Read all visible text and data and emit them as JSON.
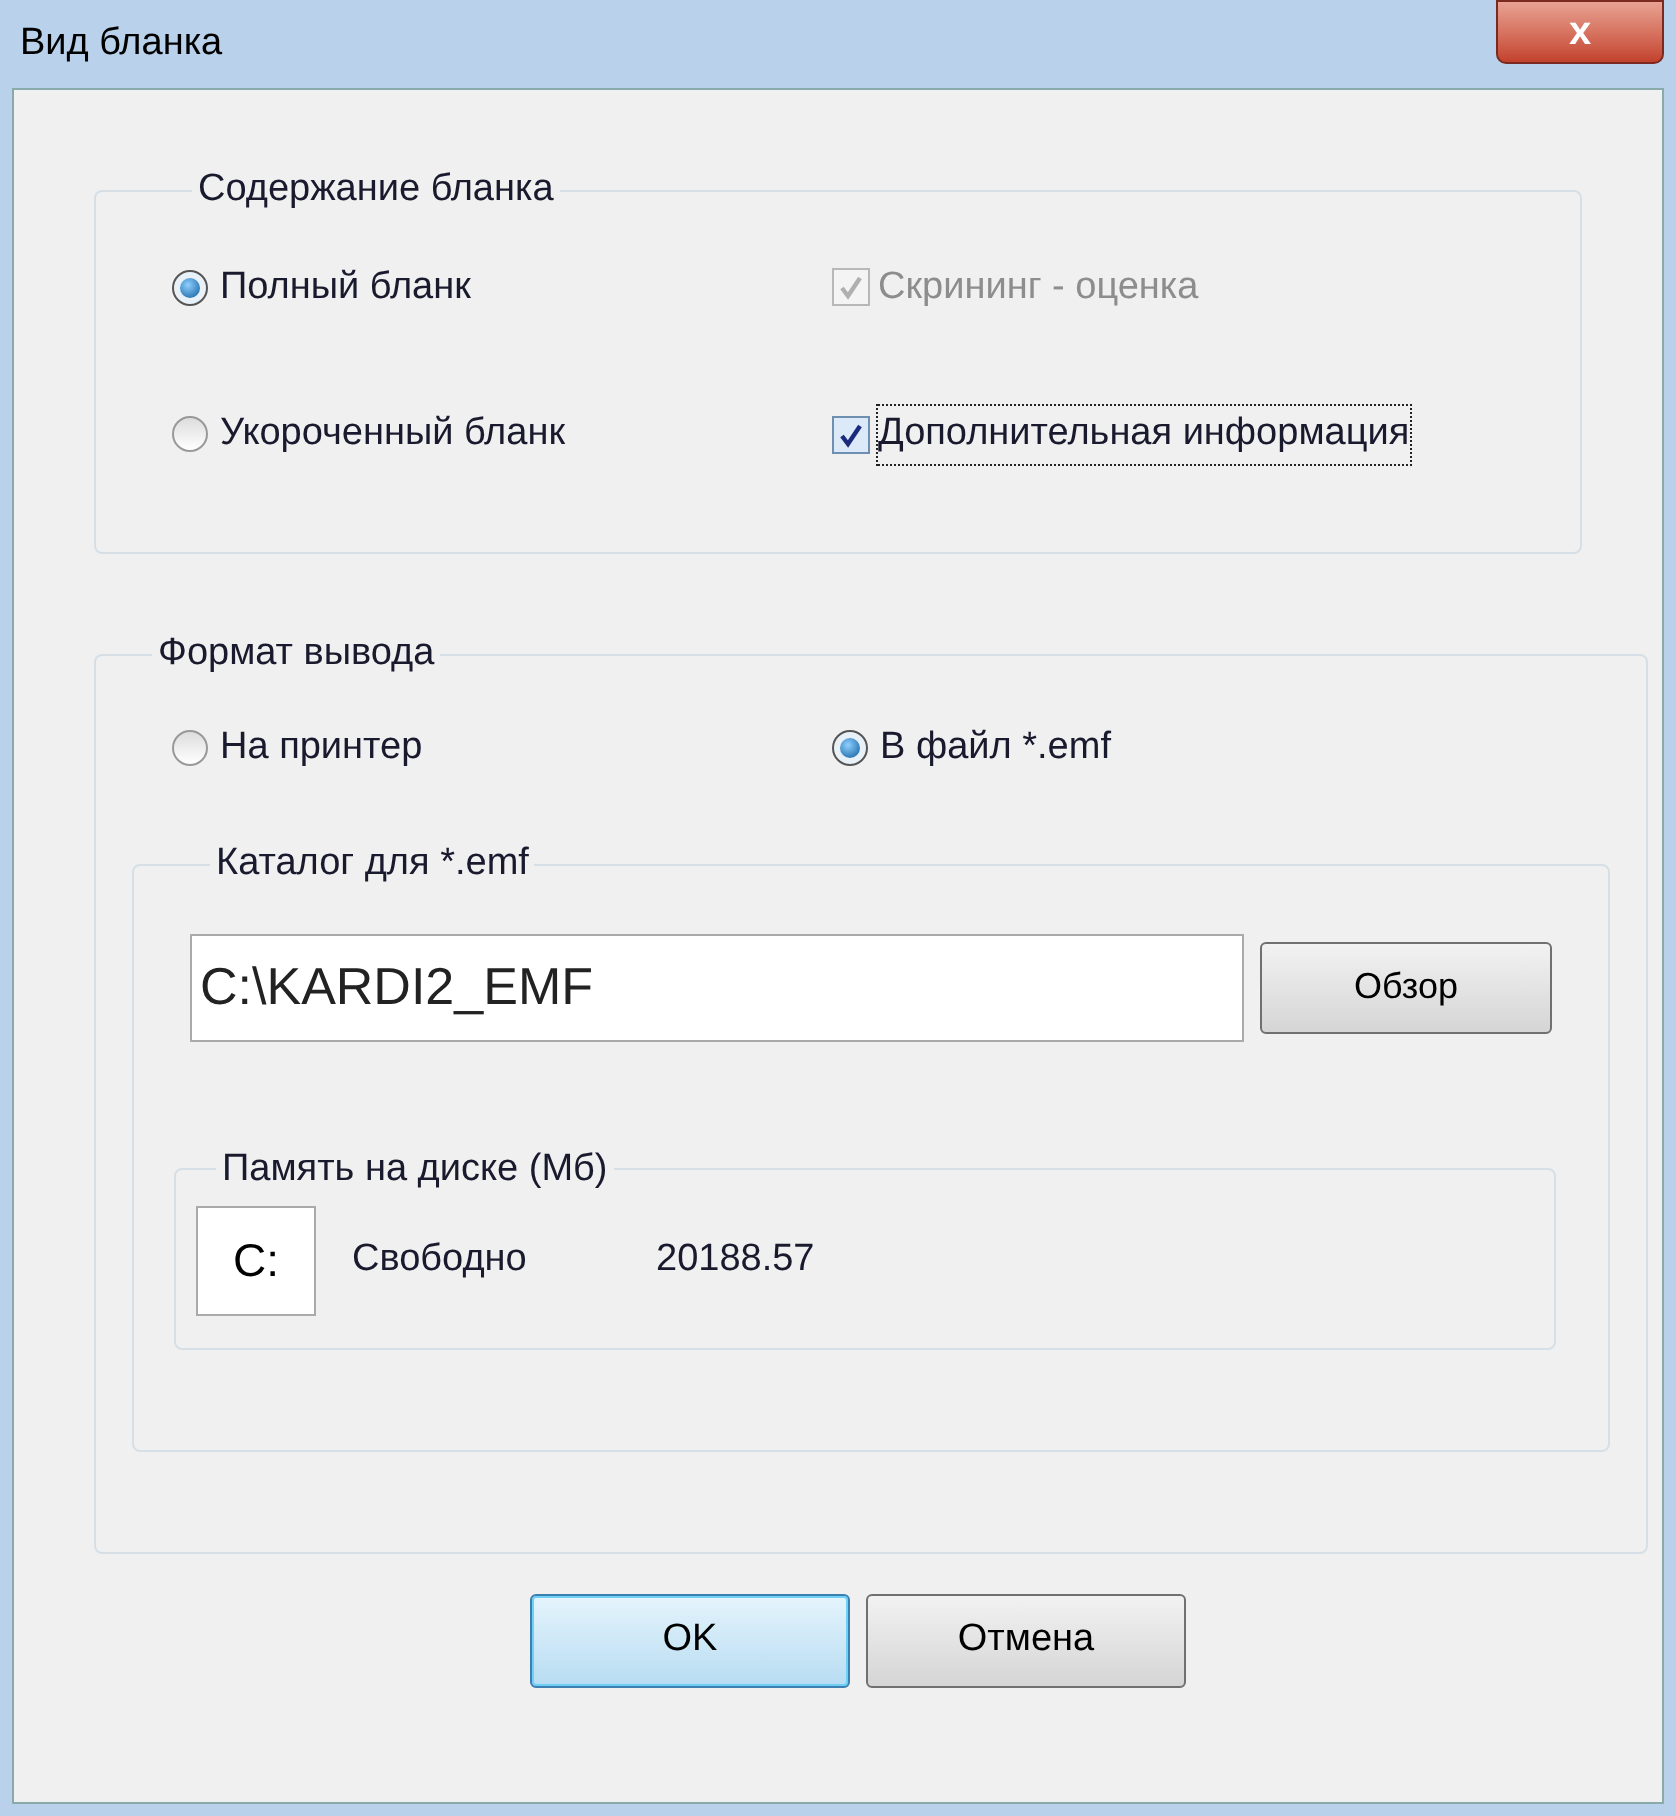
{
  "window": {
    "title": "Вид бланка",
    "close": "x"
  },
  "content_group": {
    "title": "Содержание бланка",
    "radios": [
      {
        "label": "Полный бланк",
        "selected": true
      },
      {
        "label": "Укороченный бланк",
        "selected": false
      }
    ],
    "checkboxes": [
      {
        "label": "Скрининг - оценка",
        "checked": true,
        "disabled": true,
        "focused": false
      },
      {
        "label": "Дополнительная информация",
        "checked": true,
        "disabled": false,
        "focused": true
      }
    ]
  },
  "output_group": {
    "title": "Формат вывода",
    "radios": [
      {
        "label": "На принтер",
        "selected": false
      },
      {
        "label": "В файл *.emf",
        "selected": true
      }
    ],
    "folder_group": {
      "title": "Каталог для *.emf",
      "path": "C:\\KARDI2_EMF",
      "browse_button": "Обзор",
      "disk_group": {
        "title": "Память на диске (Мб)",
        "drive": "C:",
        "free_label": "Свободно",
        "free_value": "20188.57"
      }
    }
  },
  "buttons": [
    {
      "label": "OK",
      "default": true
    },
    {
      "label": "Отмена",
      "default": false
    }
  ]
}
